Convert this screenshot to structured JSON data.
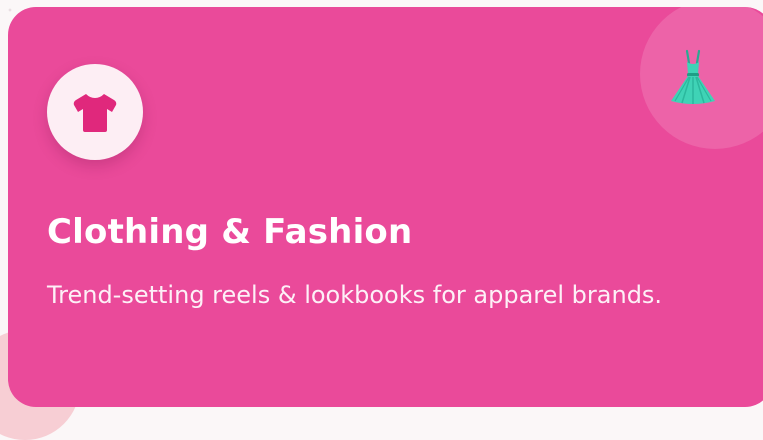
{
  "card": {
    "title": "Clothing & Fashion",
    "description": "Trend-setting reels & lookbooks for apparel brands.",
    "icon": "tshirt-icon",
    "corner_icon": "dress-icon",
    "colors": {
      "card_background": "#ea4a9a",
      "icon_color": "#e0287c",
      "icon_badge_background": "#fdeef4",
      "dress_color": "#3fd3b6",
      "text": "#ffffff"
    }
  }
}
